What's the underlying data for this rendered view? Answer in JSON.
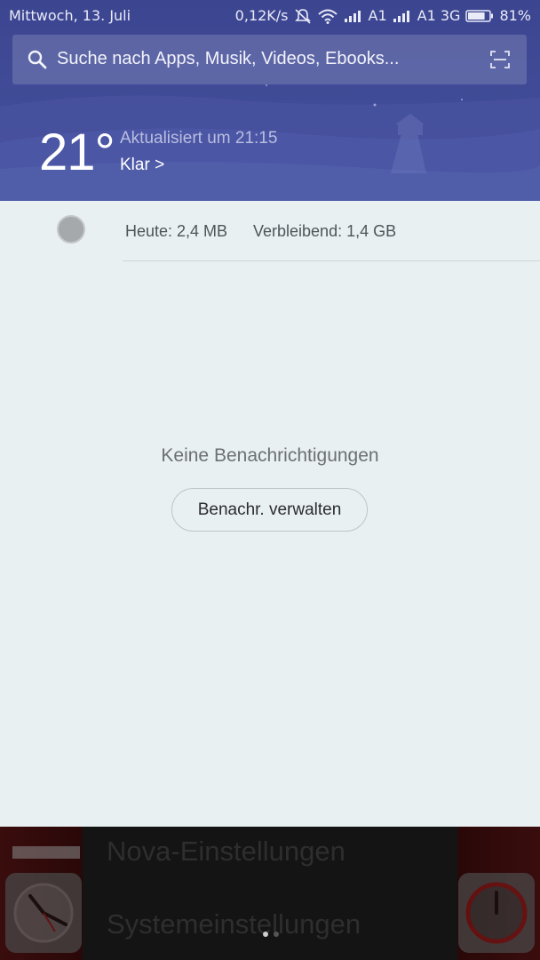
{
  "status_bar": {
    "date": "Mittwoch, 13. Juli",
    "speed": "0,12K/s",
    "carrier1": "A1",
    "carrier2": "A1 3G",
    "battery": "81%",
    "battery_level": 0.81,
    "icons": [
      "bell-off-icon",
      "wifi-icon",
      "signal-icon",
      "signal-icon",
      "battery-icon"
    ]
  },
  "search": {
    "placeholder": "Suche nach Apps, Musik, Videos, Ebooks...",
    "icon": "search-icon",
    "scan_icon": "scan-icon"
  },
  "weather": {
    "temperature": "21°",
    "updated": "Aktualisiert um 21:15",
    "condition": "Klar >"
  },
  "data_usage": {
    "today": "Heute: 2,4 MB",
    "remaining": "Verbleibend: 1,4 GB"
  },
  "notifications": {
    "empty_message": "Keine Benachrichtigungen",
    "manage_button": "Benachr. verwalten"
  },
  "home_screen": {
    "menu_items": [
      "Nova-Einstellungen",
      "Systemeinstellungen"
    ],
    "page_count": 2,
    "active_page": 0
  },
  "colors": {
    "header": "#3f4a96",
    "panel": "#e9f0f2"
  }
}
